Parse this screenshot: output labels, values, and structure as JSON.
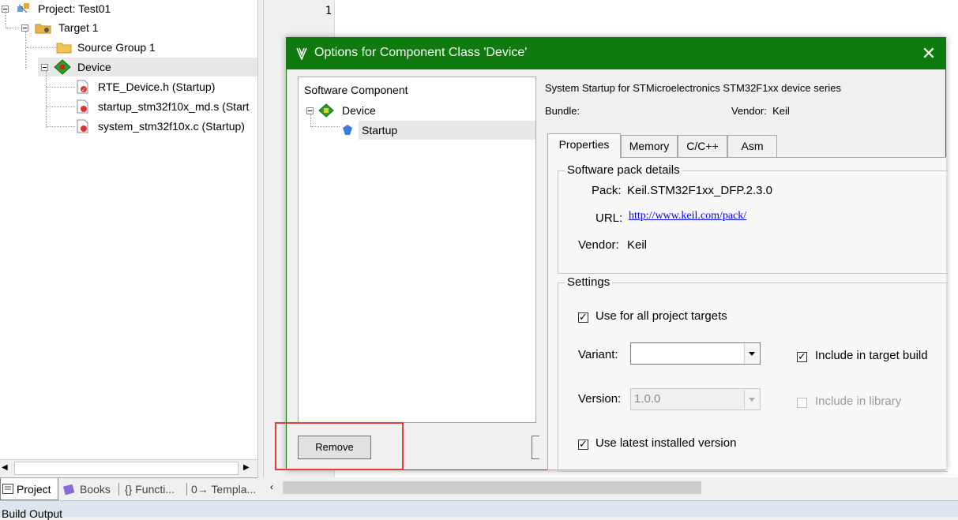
{
  "project_tree": {
    "root": "Project: Test01",
    "target": "Target 1",
    "source_group": "Source Group 1",
    "device": "Device",
    "files": [
      "RTE_Device.h (Startup)",
      "startup_stm32f10x_md.s (Start",
      "system_stm32f10x.c (Startup)"
    ]
  },
  "bottom_tabs": [
    "Project",
    "Books",
    "{} Functi...",
    "0→ Templa..."
  ],
  "editor": {
    "line_number": "1"
  },
  "build_output": "Build Output",
  "dialog": {
    "title": "Options for Component Class 'Device'",
    "close": "✕",
    "tree_header": "Software Component",
    "tree_device": "Device",
    "tree_startup": "Startup",
    "remove": "Remove",
    "description": "System Startup for STMicroelectronics STM32F1xx device series",
    "bundle_label": "Bundle:",
    "vendor_label": "Vendor:",
    "vendor_value": "Keil",
    "tabs": [
      "Properties",
      "Memory",
      "C/C++",
      "Asm"
    ],
    "pack_group": {
      "title": "Software pack details",
      "pack_label": "Pack:",
      "pack_value": "Keil.STM32F1xx_DFP.2.3.0",
      "url_label": "URL:",
      "url_value": "http://www.keil.com/pack/",
      "vendor_label": "Vendor:",
      "vendor_value": "Keil"
    },
    "settings": {
      "title": "Settings",
      "use_all_targets": "Use for all project targets",
      "variant_label": "Variant:",
      "variant_value": "",
      "include_target_build": "Include in target build",
      "version_label": "Version:",
      "version_value": "1.0.0",
      "include_library": "Include in library",
      "use_latest": "Use latest installed version"
    }
  },
  "colors": {
    "title_bar": "#0f7b0f",
    "highlight_box": "#e03c3c",
    "link": "#0000ee"
  }
}
